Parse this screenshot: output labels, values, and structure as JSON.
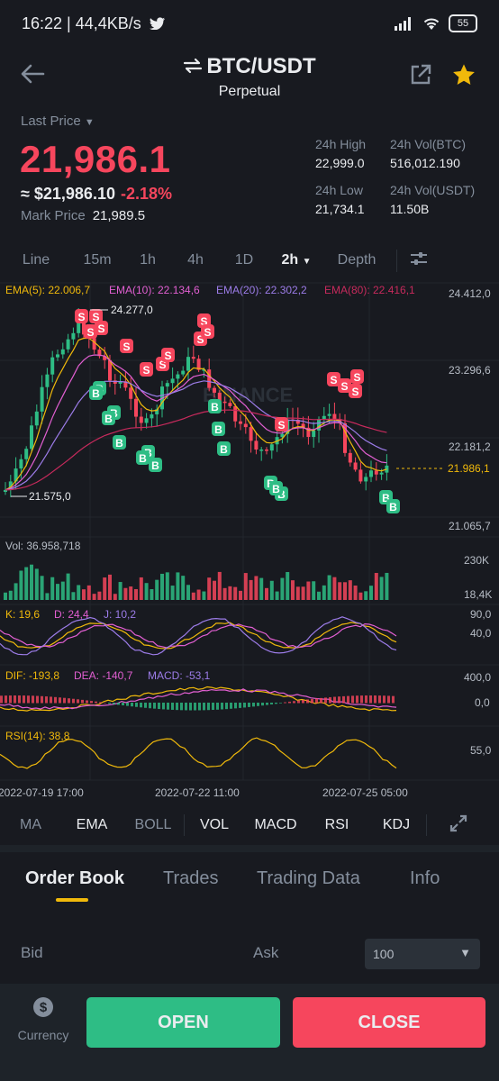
{
  "status": {
    "time": "16:22 | 44,4KB/s",
    "battery": "55"
  },
  "header": {
    "pair": "BTC/USDT",
    "subtitle": "Perpetual"
  },
  "price": {
    "last_label": "Last Price",
    "last_price": "21,986.1",
    "approx": "≈ $21,986.10",
    "change": "-2.18%",
    "mark_label": "Mark Price",
    "mark_value": "21,989.5"
  },
  "stats": {
    "high_label": "24h High",
    "high_value": "22,999.0",
    "vol_btc_label": "24h Vol(BTC)",
    "vol_btc_value": "516,012.190",
    "low_label": "24h Low",
    "low_value": "21,734.1",
    "vol_usdt_label": "24h Vol(USDT)",
    "vol_usdt_value": "11.50B"
  },
  "timeframes": [
    "Line",
    "15m",
    "1h",
    "4h",
    "1D",
    "2h",
    "Depth"
  ],
  "active_timeframe": "2h",
  "chart": {
    "ema_legend": [
      "EMA(5): 22.006,7",
      "EMA(10): 22.134,6",
      "EMA(20): 22.302,2",
      "EMA(80): 22.416,1"
    ],
    "ema_colors": [
      "#f0b90b",
      "#e25fd2",
      "#9c7ce8",
      "#c72a5c"
    ],
    "price_ticks": [
      "24.412,0",
      "23.296,6",
      "22.181,2",
      "21.065,7"
    ],
    "current_price_tag": "21.986,1",
    "max_label": "24.277,0",
    "min_label": "21.575,0",
    "watermark": "BINANCE",
    "vol_label": "Vol: 36.958,718",
    "vol_ticks": [
      "230K",
      "18,4K"
    ],
    "kdj_k": "K: 19,6",
    "kdj_d": "D: 24,4",
    "kdj_j": "J: 10,2",
    "kdj_ticks": [
      "90,0",
      "40,0"
    ],
    "macd_dif": "DIF: -193,8",
    "macd_dea": "DEA: -140,7",
    "macd_macd": "MACD: -53,1",
    "macd_ticks": [
      "400,0",
      "0,0"
    ],
    "rsi_label": "RSI(14): 38,8",
    "rsi_ticks": [
      "55,0"
    ],
    "time_labels": [
      "2022-07-19 17:00",
      "2022-07-22 11:00",
      "2022-07-25 05:00"
    ],
    "sell_marker": "S",
    "buy_marker": "B"
  },
  "indicators": [
    {
      "label": "MA",
      "dim": true
    },
    {
      "label": "EMA",
      "dim": false
    },
    {
      "label": "BOLL",
      "dim": true
    },
    {
      "label": "VOL",
      "dim": false
    },
    {
      "label": "MACD",
      "dim": false
    },
    {
      "label": "RSI",
      "dim": false
    },
    {
      "label": "KDJ",
      "dim": false
    }
  ],
  "tabs": [
    "Order Book",
    "Trades",
    "Trading Data",
    "Info"
  ],
  "orderbook": {
    "bid": "Bid",
    "ask": "Ask",
    "depth_value": "100"
  },
  "bottom": {
    "currency": "Currency",
    "open": "OPEN",
    "close": "CLOSE"
  },
  "colors": {
    "up": "#2ebd85",
    "down": "#f6465d",
    "accent": "#f0b90b",
    "bg": "#181a20"
  }
}
